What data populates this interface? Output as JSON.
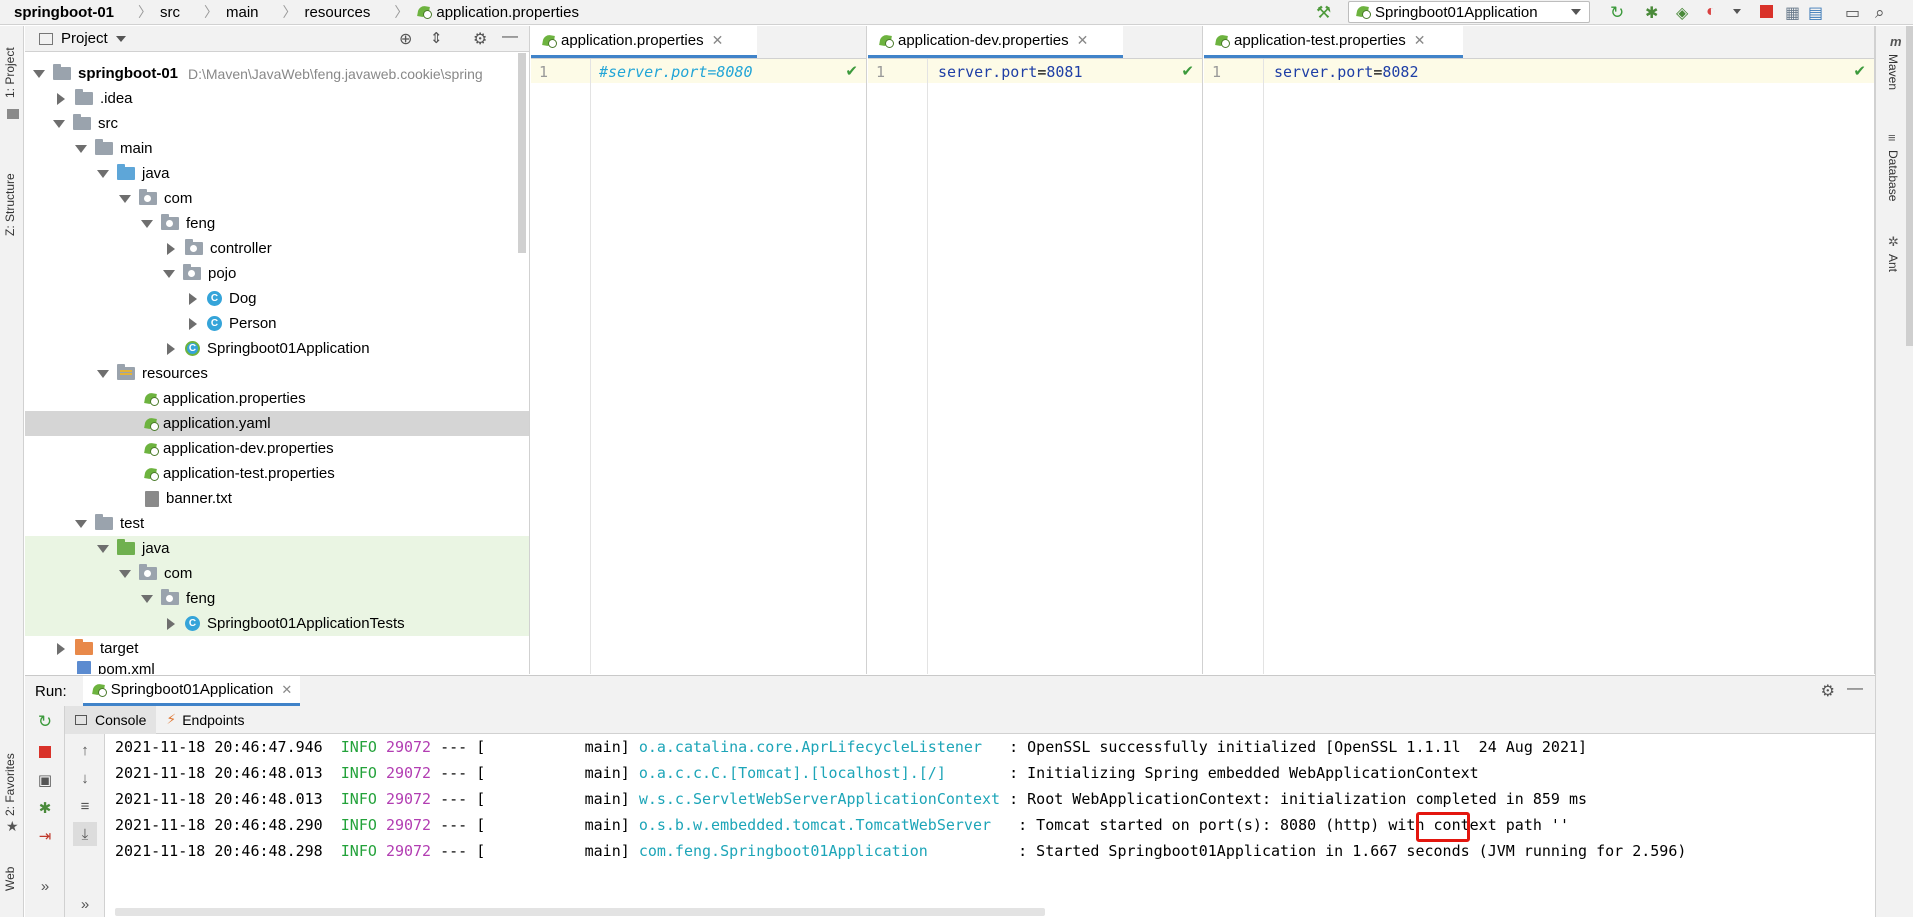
{
  "breadcrumb": [
    "springboot-01",
    "src",
    "main",
    "resources",
    "application.properties"
  ],
  "toolbar": {
    "run_config": "Springboot01Application"
  },
  "left_strip": {
    "project": "1: Project",
    "structure": "Z: Structure",
    "favorites": "2: Favorites",
    "web": "Web"
  },
  "right_strip": {
    "maven": "Maven",
    "database": "Database",
    "ant": "Ant"
  },
  "project": {
    "title": "Project",
    "root_name": "springboot-01",
    "root_path": "D:\\Maven\\JavaWeb\\feng.javaweb.cookie\\spring",
    "items": [
      ".idea",
      "src",
      "main",
      "java",
      "com",
      "feng",
      "controller",
      "pojo",
      "Dog",
      "Person",
      "Springboot01Application",
      "resources",
      "application.properties",
      "application.yaml",
      "application-dev.properties",
      "application-test.properties",
      "banner.txt",
      "test",
      "java",
      "com",
      "feng",
      "Springboot01ApplicationTests",
      "target",
      "pom.xml"
    ]
  },
  "editors": [
    {
      "tab": "application.properties",
      "line_no": "1",
      "code_comment": "#server.port=8080"
    },
    {
      "tab": "application-dev.properties",
      "line_no": "1",
      "key": "server.port",
      "eq": "=",
      "value": "8081"
    },
    {
      "tab": "application-test.properties",
      "line_no": "1",
      "key": "server.port",
      "eq": "=",
      "value": "8082"
    }
  ],
  "run": {
    "label": "Run:",
    "tab": "Springboot01Application",
    "console_tab": "Console",
    "endpoints_tab": "Endpoints",
    "logs": [
      {
        "ts": "2021-11-18 20:46:47.946",
        "level": "INFO",
        "pid": "29072",
        "sep": "--- [",
        "thread": "           main]",
        "logger": "o.a.catalina.core.AprLifecycleListener  ",
        "msg": " : OpenSSL successfully initialized [OpenSSL 1.1.1l  24 Aug 2021]"
      },
      {
        "ts": "2021-11-18 20:46:48.013",
        "level": "INFO",
        "pid": "29072",
        "sep": "--- [",
        "thread": "           main]",
        "logger": "o.a.c.c.C.[Tomcat].[localhost].[/]      ",
        "msg": " : Initializing Spring embedded WebApplicationContext"
      },
      {
        "ts": "2021-11-18 20:46:48.013",
        "level": "INFO",
        "pid": "29072",
        "sep": "--- [",
        "thread": "           main]",
        "logger": "w.s.c.ServletWebServerApplicationContext",
        "msg": " : Root WebApplicationContext: initialization completed in 859 ms"
      },
      {
        "ts": "2021-11-18 20:46:48.290",
        "level": "INFO",
        "pid": "29072",
        "sep": "--- [",
        "thread": "           main]",
        "logger": "o.s.b.w.embedded.tomcat.TomcatWebServer  ",
        "msg": " : Tomcat started on port(s): 8080 (http) with context path ''"
      },
      {
        "ts": "2021-11-18 20:46:48.298",
        "level": "INFO",
        "pid": "29072",
        "sep": "--- [",
        "thread": "           main]",
        "logger": "com.feng.Springboot01Application         ",
        "msg": " : Started Springboot01Application in 1.667 seconds (JVM running for 2.596)"
      }
    ]
  },
  "colors": {
    "accent_tab": "#4083c9",
    "highlight_box": "#e3160e",
    "info": "#23a23a",
    "pid": "#b23db2",
    "logger": "#1da5b8"
  }
}
